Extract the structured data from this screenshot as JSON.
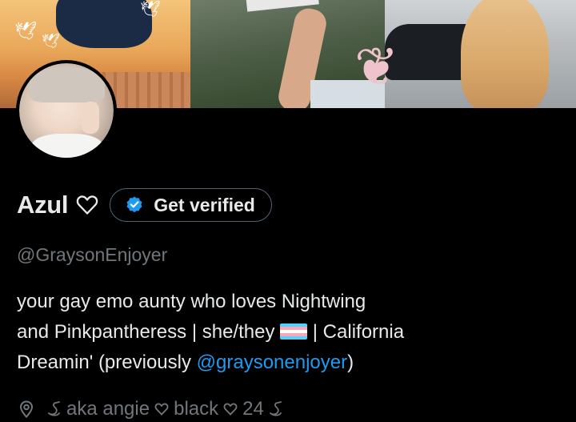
{
  "profile": {
    "display_name": "Azul",
    "verify_label": "Get verified",
    "handle": "@GraysonEnjoyer",
    "bio": {
      "line1": "your gay emo aunty who loves Nightwing",
      "line2_a": "and Pinkpantheress | she/they ",
      "line2_b": " | California",
      "line3_a": "Dreamin'  (previously ",
      "mention": "@graysonenjoyer",
      "line3_b": ")"
    },
    "location": {
      "text_a": "aka angie",
      "text_b": "black",
      "text_c": "24"
    }
  },
  "icons": {
    "name_heart": "heart-outline-icon",
    "verify": "verified-badge-icon",
    "location": "location-pin-icon",
    "swan": "swan-icon",
    "small_heart": "heart-outline-icon"
  },
  "colors": {
    "background": "#000000",
    "text_primary": "#e7e9ea",
    "text_secondary": "#71767b",
    "link": "#1d9bf0",
    "verified_blue": "#1d9bf0",
    "button_border": "#536471"
  }
}
